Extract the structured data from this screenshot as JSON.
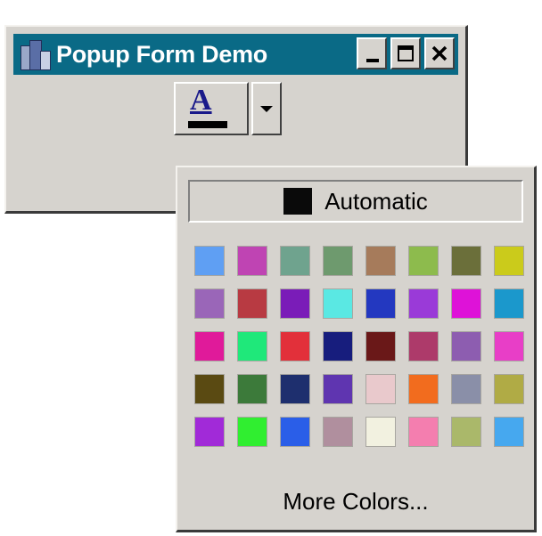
{
  "window": {
    "title": "Popup Form Demo"
  },
  "font_color_button": {
    "glyph": "A",
    "current_color": "#000000"
  },
  "popup": {
    "automatic": {
      "label": "Automatic",
      "color": "#0a0a0a"
    },
    "palette": [
      [
        "#5f9ff3",
        "#bf44b3",
        "#6fa38e",
        "#6e9a6e",
        "#a67b5b",
        "#8dbb4d",
        "#6b6f3a",
        "#cbcb1b"
      ],
      [
        "#9a66b8",
        "#b83a42",
        "#7a1cb8",
        "#5ae8e3",
        "#2338c0",
        "#9a3ad8",
        "#de12d8",
        "#1b98cc"
      ],
      [
        "#e01a9a",
        "#1fe87a",
        "#e2303a",
        "#171d7d",
        "#6a1818",
        "#ad3a6a",
        "#8d5db0",
        "#e83ec7"
      ],
      [
        "#5a4a12",
        "#3c7a3a",
        "#1e2f6e",
        "#5f35b0",
        "#e9c9cc",
        "#f26c1e",
        "#8a8fa8",
        "#b0ab45"
      ],
      [
        "#a12ad8",
        "#30ee30",
        "#2a5ee8",
        "#b08f9e",
        "#f2f1e0",
        "#f47eaf",
        "#aab86a",
        "#46a8ef"
      ]
    ],
    "more_label": "More Colors..."
  }
}
